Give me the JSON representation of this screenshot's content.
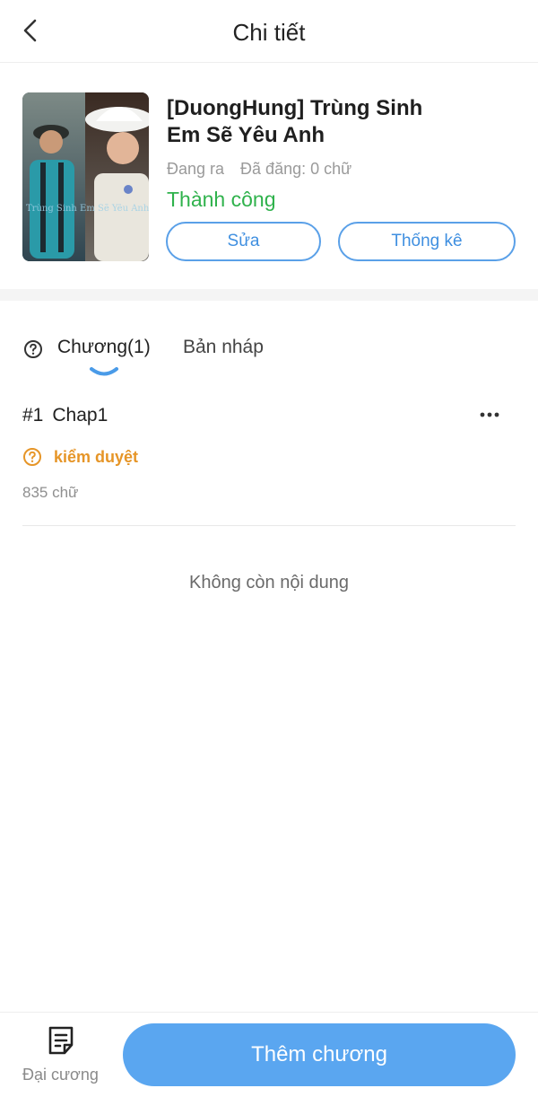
{
  "header": {
    "title": "Chi tiết",
    "back_icon": "chevron-left-icon"
  },
  "book": {
    "title_line1": "[DuongHung] Trùng Sinh",
    "title_line2": "Em Sẽ Yêu Anh",
    "status_label": "Đang ra",
    "published_label": "Đã đăng: 0 chữ",
    "review_status": "Thành công",
    "edit_label": "Sửa",
    "stats_label": "Thống kê",
    "cover_caption": "Trùng Sinh Em Sẽ Yêu Anh"
  },
  "tabs": [
    {
      "label": "Chương(1)",
      "active": true
    },
    {
      "label": "Bản nháp",
      "active": false
    }
  ],
  "chapters": [
    {
      "number": "#1",
      "name": "Chap1",
      "status": "kiểm duyệt",
      "word_count": "835 chữ"
    }
  ],
  "list_end_text": "Không còn nội dung",
  "bottom": {
    "outline_label": "Đại cương",
    "add_chapter_label": "Thêm chương"
  },
  "colors": {
    "accent": "#5aa6f0",
    "success": "#2fb24c",
    "warning": "#e69527"
  }
}
